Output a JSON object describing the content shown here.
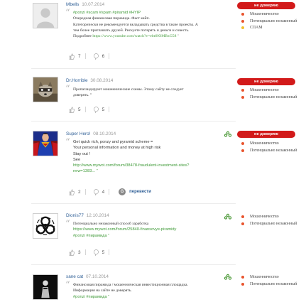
{
  "reviews": [
    {
      "username": "Mbells",
      "date": "10.07.2014",
      "avatar": "default-silhouette",
      "lines": [
        {
          "text": "#ponzi #scam #spam #piramid #HYIP",
          "style": "green"
        },
        {
          "text": "Очередная финансовая пирамида. Фаст кайп.",
          "style": "serif"
        },
        {
          "text": "Категорически не рекомендуется вкладывать средства в такие проекты. А",
          "style": "serif"
        },
        {
          "text": "тем более приглашать друзей. Рискуете потерять и деньги и совесть.",
          "style": "serif"
        },
        {
          "text": "Подробнее ",
          "style": "serif",
          "link": "https://www.youtube.com/watch?v=ebeHOMBxG58"
        }
      ],
      "likes": "7",
      "comments": "6",
      "badge": "не доверяю",
      "tags": [
        {
          "label": "Мошенничество",
          "color": "#e8542e"
        },
        {
          "label": "Потенциально незаконный",
          "color": "#e8542e"
        },
        {
          "label": "СПАМ",
          "color": "#f2c12e"
        }
      ]
    },
    {
      "username": "Dr.Horrible",
      "date": "30.08.2014",
      "avatar": "raccoon",
      "lines": [
        {
          "text": "Пропагандируют мошеннические схемы. Этому сайту не следует",
          "style": "serif"
        },
        {
          "text": "доверять. ”",
          "style": "serif"
        }
      ],
      "likes": "5",
      "comments": "5",
      "badge": "не доверяю",
      "tags": [
        {
          "label": "Мошенничество",
          "color": "#e8542e"
        },
        {
          "label": "Потенциально незаконный",
          "color": "#e8542e"
        }
      ]
    },
    {
      "username": "Super Hero!",
      "date": "08.10.2014",
      "avatar": "superhero",
      "lines": [
        {
          "text": "Get quick rich, ponzy and pyramid scheme =",
          "style": "plain"
        },
        {
          "text": "Your personal information and money at high risk",
          "style": "plain"
        },
        {
          "text": "Stay out !",
          "style": "plain"
        },
        {
          "text": "See",
          "style": "plain"
        },
        {
          "text": "http://www.mywot.com/forum/38478-fraudulent-investment-sites?",
          "style": "green"
        },
        {
          "text": "new=1383... ”",
          "style": "green"
        }
      ],
      "likes": "2",
      "comments": "4",
      "translate": "перевести",
      "badge": "не доверяю",
      "tags": [
        {
          "label": "Мошенничество",
          "color": "#e8542e"
        },
        {
          "label": "Потенциально незаконный",
          "color": "#e8542e"
        }
      ]
    },
    {
      "username": "Dionis77",
      "date": "12.10.2014",
      "avatar": "biohazard",
      "lines": [
        {
          "text": "Потенциально незаконный способ заработка",
          "style": "serif"
        },
        {
          "text": "https://www.mywot.com/forum/25840-finansovye-piramidy",
          "style": "green"
        },
        {
          "text": "#ponzi #пирамида ”",
          "style": "green"
        }
      ],
      "likes": "3",
      "comments": "5",
      "tags": [
        {
          "label": "Мошенничество",
          "color": "#e8542e"
        },
        {
          "label": "Потенциально незаконный",
          "color": "#e8542e"
        }
      ]
    },
    {
      "username": "sane cat",
      "date": "07.10.2014",
      "avatar": "black-figure",
      "lines": [
        {
          "text": "Финансовая пирамида / мошенническая инвестиционная площадка.",
          "style": "serif"
        },
        {
          "text": "Информация на сайте не доверять.",
          "style": "serif"
        },
        {
          "text": "#ponzi #пирамида ”",
          "style": "green"
        }
      ],
      "tags": [
        {
          "label": "Мошенничество",
          "color": "#e8542e"
        },
        {
          "label": "Потенциально незаконный",
          "color": "#e8542e"
        }
      ]
    }
  ],
  "colors": {
    "badge": "#d21a1a",
    "link": "#3f9a38",
    "username": "#2f5f96",
    "tag_red": "#e8542e",
    "tag_yellow": "#f2c12e"
  }
}
